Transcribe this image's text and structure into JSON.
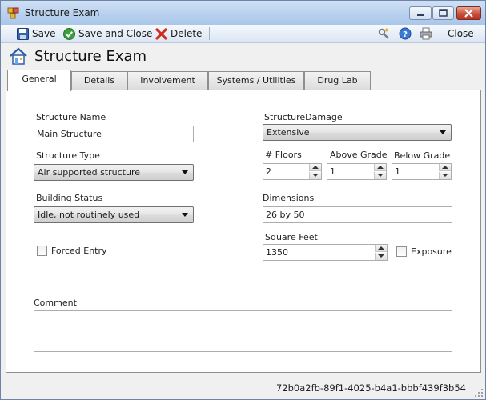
{
  "window": {
    "title": "Structure Exam"
  },
  "toolbar": {
    "save_label": "Save",
    "save_close_label": "Save and Close",
    "delete_label": "Delete",
    "close_label": "Close",
    "icons": [
      "save-icon",
      "checkmark-icon",
      "delete-x-icon",
      "tools-icon",
      "help-icon",
      "print-icon"
    ]
  },
  "header": {
    "title": "Structure Exam"
  },
  "tabs": [
    {
      "label": "General",
      "active": true
    },
    {
      "label": "Details",
      "active": false
    },
    {
      "label": "Involvement",
      "active": false
    },
    {
      "label": "Systems / Utilities",
      "active": false
    },
    {
      "label": "Drug Lab",
      "active": false
    }
  ],
  "form": {
    "structure_name": {
      "label": "Structure Name",
      "value": "Main Structure"
    },
    "structure_type": {
      "label": "Structure Type",
      "value": "Air supported structure"
    },
    "building_status": {
      "label": "Building Status",
      "value": "Idle, not routinely used"
    },
    "forced_entry": {
      "label": "Forced Entry",
      "checked": false
    },
    "structure_damage": {
      "label": "StructureDamage",
      "value": "Extensive"
    },
    "floors": {
      "label": "# Floors",
      "value": "2"
    },
    "above_grade": {
      "label": "Above Grade",
      "value": "1"
    },
    "below_grade": {
      "label": "Below Grade",
      "value": "1"
    },
    "dimensions": {
      "label": "Dimensions",
      "value": "26 by 50"
    },
    "square_feet": {
      "label": "Square Feet",
      "value": "1350"
    },
    "exposure": {
      "label": "Exposure",
      "checked": false
    },
    "comment": {
      "label": "Comment",
      "value": ""
    }
  },
  "status": {
    "record_id": "72b0a2fb-89f1-4025-b4a1-bbbf439f3b54"
  },
  "colors": {
    "titlebar": "#b9d1ee",
    "close_button": "#c94f3c",
    "panel": "#ffffff",
    "background": "#f0f0f0"
  }
}
